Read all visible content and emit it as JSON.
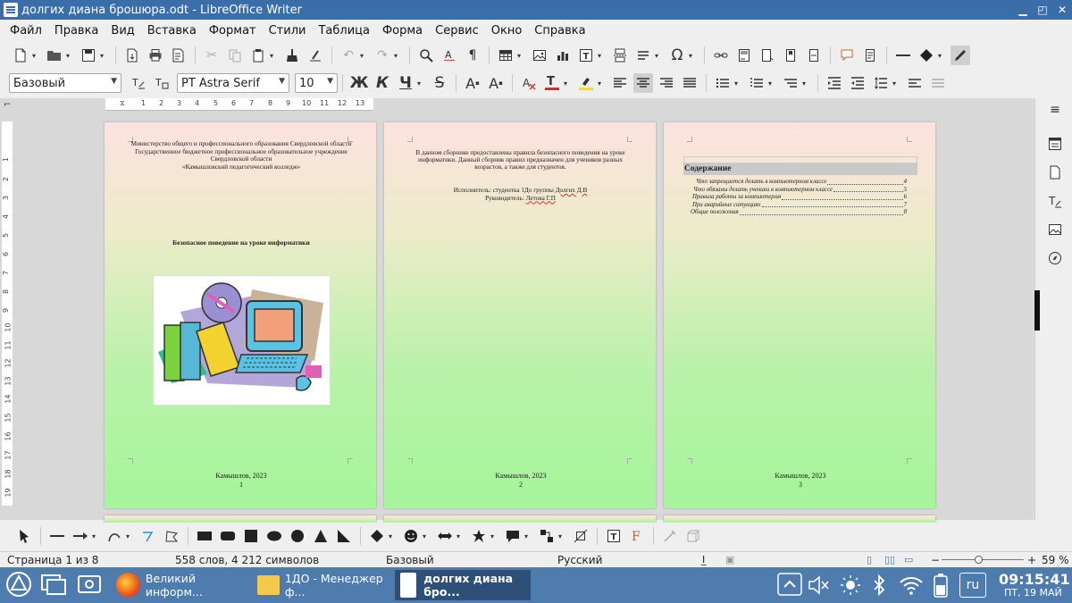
{
  "window": {
    "title": "долгих диана брошюра.odt - LibreOffice Writer"
  },
  "menu": [
    "Файл",
    "Правка",
    "Вид",
    "Вставка",
    "Формат",
    "Стили",
    "Таблица",
    "Форма",
    "Сервис",
    "Окно",
    "Справка"
  ],
  "format_bar": {
    "paragraph_style": "Базовый",
    "font_name": "PT Astra Serif",
    "font_size": "10",
    "bold_glyph": "Ж",
    "italic_glyph": "К",
    "underline_glyph": "Ч",
    "strike_glyph": "S",
    "super_glyph": "A",
    "sub_glyph": "A"
  },
  "ruler": {
    "h_marks": [
      "1",
      "2",
      "3",
      "4",
      "5",
      "6",
      "7",
      "8",
      "9",
      "10",
      "11",
      "12",
      "13"
    ],
    "v_marks": [
      "1",
      "2",
      "3",
      "4",
      "5",
      "6",
      "7",
      "8",
      "9",
      "10",
      "11",
      "12",
      "13",
      "14",
      "15",
      "16",
      "17",
      "18",
      "19"
    ]
  },
  "pages": {
    "p1": {
      "org_lines": [
        "Министерство общего и профессионального образования Свердловской области",
        "Государственное бюджетное профессиональное образовательное учреждение",
        "Свердловской области",
        "«Камышловский педагогический колледж»"
      ],
      "heading": "Безопасное поведение на уроке информатики",
      "city": "Камышлов, 2023",
      "number": "1"
    },
    "p2": {
      "intro": "В данном сборнике предоставлены правила безопасного поведения на уроке информатики. Данный сборник правил предназначен для учеников разных возрастов, а также для студентов.",
      "executor_label": "Исполнитель: студентка 1До группы ",
      "executor_name": "Долгих Д.В",
      "supervisor_label": "Руководитель: ",
      "supervisor_name": "Летова Г.П",
      "city": "Камышлов, 2023",
      "number": "2"
    },
    "p3": {
      "toc_title": "Содержание",
      "toc": [
        {
          "title": "Что запрещается делать в компьютерном классе",
          "page": "4"
        },
        {
          "title": "Что обязаны делать ученики в компьютерном классе",
          "page": "5"
        },
        {
          "title": "Правила работы за компьютером",
          "page": "6"
        },
        {
          "title": "При аварийных ситуациях",
          "page": "7"
        },
        {
          "title": "Общие положения",
          "page": "8"
        }
      ],
      "city": "Камышлов, 2023",
      "number": "3"
    }
  },
  "status": {
    "page": "Страница 1 из 8",
    "words": "558 слов, 4 212 символов",
    "style": "Базовый",
    "language": "Русский",
    "zoom": "59 %",
    "zoom_fraction": 0.45
  },
  "taskbar": {
    "tasks": [
      "Великий информ...",
      "1ДО - Менеджер ф...",
      "долгих диана бро..."
    ],
    "lang": "ru",
    "time": "09:15:41",
    "date": "ПТ, 19 МАЙ"
  },
  "colors": {
    "titlebar": "#3b6ea8",
    "taskbar": "#4f7cae",
    "font_color": "#d0312d",
    "highlight": "#f5e400"
  }
}
